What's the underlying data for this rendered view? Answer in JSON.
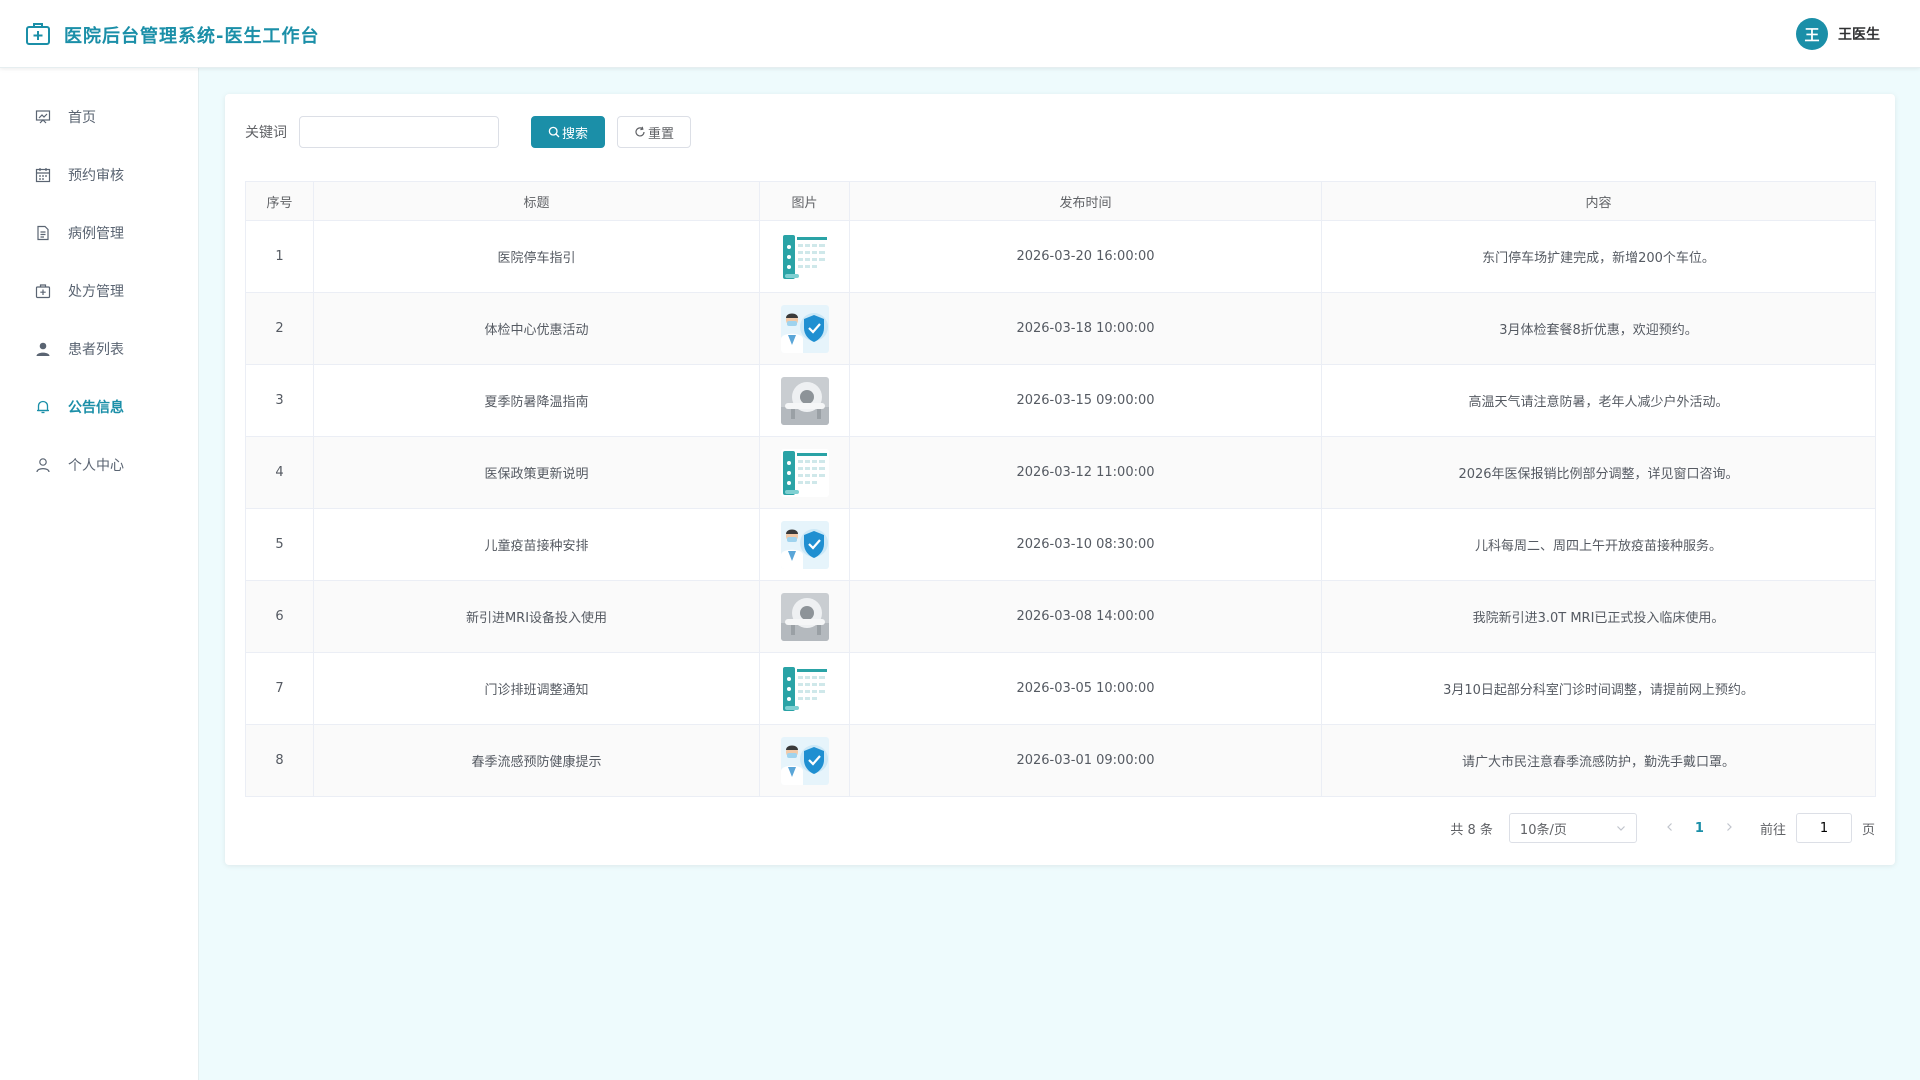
{
  "header": {
    "title": "医院后台管理系统-医生工作台",
    "user_initial": "王",
    "user_name": "王医生",
    "accent_color": "#1b8fa8"
  },
  "sidebar": {
    "items": [
      {
        "label": "首页",
        "icon": "presentation-board-icon",
        "active": false
      },
      {
        "label": "预约审核",
        "icon": "calendar-icon",
        "active": false
      },
      {
        "label": "病例管理",
        "icon": "document-icon",
        "active": false
      },
      {
        "label": "处方管理",
        "icon": "medical-kit-icon",
        "active": false
      },
      {
        "label": "患者列表",
        "icon": "user-filled-icon",
        "active": false
      },
      {
        "label": "公告信息",
        "icon": "bell-icon",
        "active": true
      },
      {
        "label": "个人中心",
        "icon": "user-icon",
        "active": false
      }
    ]
  },
  "search": {
    "label": "关键词",
    "value": "",
    "placeholder": "",
    "search_button": "搜索",
    "reset_button": "重置"
  },
  "table": {
    "columns": [
      "序号",
      "标题",
      "图片",
      "发布时间",
      "内容"
    ],
    "rows": [
      {
        "index": "1",
        "title": "医院停车指引",
        "image": "schedule-board",
        "time": "2026-03-20 16:00:00",
        "content": "东门停车场扩建完成，新增200个车位。"
      },
      {
        "index": "2",
        "title": "体检中心优惠活动",
        "image": "doctor-shield",
        "time": "2026-03-18 10:00:00",
        "content": "3月体检套餐8折优惠，欢迎预约。"
      },
      {
        "index": "3",
        "title": "夏季防暑降温指南",
        "image": "mri-machine",
        "time": "2026-03-15 09:00:00",
        "content": "高温天气请注意防暑，老年人减少户外活动。"
      },
      {
        "index": "4",
        "title": "医保政策更新说明",
        "image": "schedule-board",
        "time": "2026-03-12 11:00:00",
        "content": "2026年医保报销比例部分调整，详见窗口咨询。"
      },
      {
        "index": "5",
        "title": "儿童疫苗接种安排",
        "image": "doctor-shield",
        "time": "2026-03-10 08:30:00",
        "content": "儿科每周二、周四上午开放疫苗接种服务。"
      },
      {
        "index": "6",
        "title": "新引进MRI设备投入使用",
        "image": "mri-machine",
        "time": "2026-03-08 14:00:00",
        "content": "我院新引进3.0T MRI已正式投入临床使用。"
      },
      {
        "index": "7",
        "title": "门诊排班调整通知",
        "image": "schedule-board",
        "time": "2026-03-05 10:00:00",
        "content": "3月10日起部分科室门诊时间调整，请提前网上预约。"
      },
      {
        "index": "8",
        "title": "春季流感预防健康提示",
        "image": "doctor-shield",
        "time": "2026-03-01 09:00:00",
        "content": "请广大市民注意春季流感防护，勤洗手戴口罩。"
      }
    ]
  },
  "pagination": {
    "total_text": "共 8 条",
    "page_size": "10条/页",
    "current_page": "1",
    "goto_label": "前往",
    "goto_value": "1",
    "goto_suffix": "页"
  }
}
